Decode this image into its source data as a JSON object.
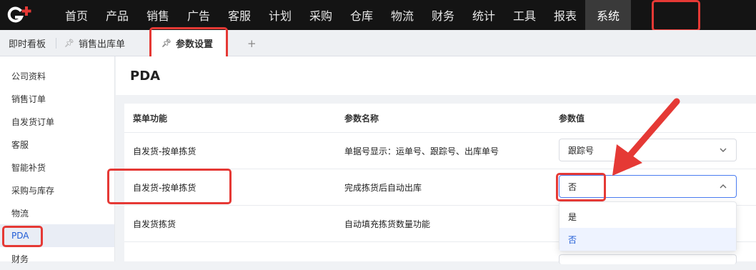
{
  "logo": {
    "icon": "g-plus-logo",
    "accent": "#e53935"
  },
  "nav": {
    "items": [
      "首页",
      "产品",
      "销售",
      "广告",
      "客服",
      "计划",
      "采购",
      "仓库",
      "物流",
      "财务",
      "统计",
      "工具",
      "报表",
      "系统"
    ],
    "active": "系统"
  },
  "tabs": {
    "items": [
      "即时看板",
      "销售出库单",
      "参数设置"
    ],
    "active": "参数设置",
    "add_label": "+"
  },
  "sidebar": {
    "items": [
      "公司资料",
      "销售订单",
      "自发货订单",
      "客服",
      "智能补货",
      "采购与库存",
      "物流",
      "PDA",
      "财务"
    ],
    "active": "PDA"
  },
  "page": {
    "title": "PDA"
  },
  "table": {
    "headers": [
      "菜单功能",
      "参数名称",
      "参数值"
    ],
    "rows": [
      {
        "menu": "自发货-按单拣货",
        "param": "单据号显示：运单号、跟踪号、出库单号",
        "value": "跟踪号"
      },
      {
        "menu": "自发货-按单拣货",
        "param": "完成拣货后自动出库",
        "value": "否"
      },
      {
        "menu": "自发货拣货",
        "param": "自动填充拣货数量功能",
        "value": ""
      }
    ]
  },
  "dropdown": {
    "options": [
      "是",
      "否"
    ],
    "selected": "否"
  },
  "colors": {
    "highlight": "#e53935",
    "link": "#1f5bd6",
    "nav_bg": "#141414"
  }
}
